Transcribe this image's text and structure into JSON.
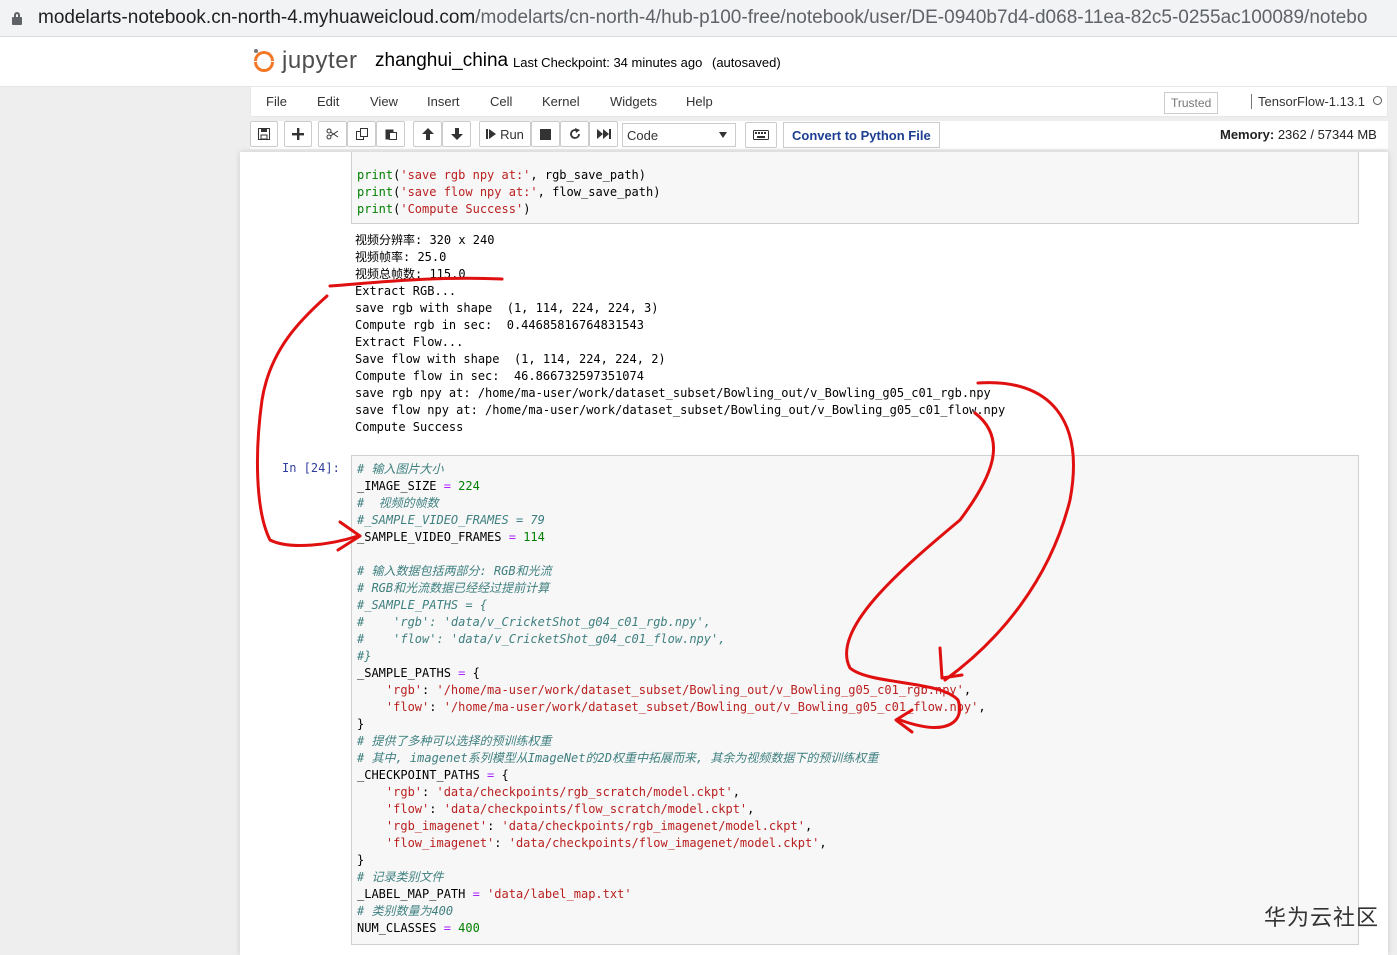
{
  "browser": {
    "url_host": "modelarts-notebook.cn-north-4.myhuaweicloud.com",
    "url_path": "/modelarts/cn-north-4/hub-p100-free/notebook/user/DE-0940b7d4-d068-11ea-82c5-0255ac100089/notebo"
  },
  "header": {
    "logo_text": "jupyter",
    "notebook_name": "zhanghui_china",
    "checkpoint": "Last Checkpoint: 34 minutes ago",
    "autosave": "(autosaved)"
  },
  "menubar": {
    "items": [
      "File",
      "Edit",
      "View",
      "Insert",
      "Cell",
      "Kernel",
      "Widgets",
      "Help"
    ],
    "trusted": "Trusted",
    "kernel": "TensorFlow-1.13.1"
  },
  "toolbar": {
    "run_label": "Run",
    "cell_type": "Code",
    "convert_label": "Convert to Python File",
    "memory_label": "Memory:",
    "memory_value": "2362 / 57344 MB"
  },
  "cell1": {
    "input_lines": [
      "print('save rgb npy at:', rgb_save_path)",
      "print('save flow npy at:', flow_save_path)",
      "print('Compute Success')"
    ],
    "output_lines": [
      "视频分辨率: 320 x 240",
      "视频帧率: 25.0",
      "视频总帧数: 115.0",
      "Extract RGB...",
      "save rgb with shape  (1, 114, 224, 224, 3)",
      "Compute rgb in sec:  0.44685816764831543",
      "Extract Flow...",
      "Save flow with shape  (1, 114, 224, 224, 2)",
      "Compute flow in sec:  46.866732597351074",
      "save rgb npy at: /home/ma-user/work/dataset_subset/Bowling_out/v_Bowling_g05_c01_rgb.npy",
      "save flow npy at: /home/ma-user/work/dataset_subset/Bowling_out/v_Bowling_g05_c01_flow.npy",
      "Compute Success"
    ]
  },
  "cell2": {
    "prompt": "In  [24]:",
    "lines": [
      "# 输入图片大小",
      "_IMAGE_SIZE = 224",
      "#  视频的帧数",
      "#_SAMPLE_VIDEO_FRAMES = 79",
      "_SAMPLE_VIDEO_FRAMES = 114",
      "",
      "# 输入数据包括两部分: RGB和光流",
      "# RGB和光流数据已经经过提前计算",
      "#_SAMPLE_PATHS = {",
      "#    'rgb': 'data/v_CricketShot_g04_c01_rgb.npy',",
      "#    'flow': 'data/v_CricketShot_g04_c01_flow.npy',",
      "#}",
      "_SAMPLE_PATHS = {",
      "    'rgb': '/home/ma-user/work/dataset_subset/Bowling_out/v_Bowling_g05_c01_rgb.npy',",
      "    'flow': '/home/ma-user/work/dataset_subset/Bowling_out/v_Bowling_g05_c01_flow.npy',",
      "}",
      "# 提供了多种可以选择的预训练权重",
      "# 其中, imagenet系列模型从ImageNet的2D权重中拓展而来, 其余为视频数据下的预训练权重",
      "_CHECKPOINT_PATHS = {",
      "    'rgb': 'data/checkpoints/rgb_scratch/model.ckpt',",
      "    'flow': 'data/checkpoints/flow_scratch/model.ckpt',",
      "    'rgb_imagenet': 'data/checkpoints/rgb_imagenet/model.ckpt',",
      "    'flow_imagenet': 'data/checkpoints/flow_imagenet/model.ckpt',",
      "}",
      "# 记录类别文件",
      "_LABEL_MAP_PATH = 'data/label_map.txt'",
      "# 类别数量为400",
      "NUM_CLASSES = 400"
    ]
  },
  "watermark": "华为云社区",
  "colors": {
    "annotation": "#e01010",
    "jupyter_orange": "#f37726",
    "comment": "#408080",
    "string": "#ba2121",
    "number": "#008000"
  }
}
